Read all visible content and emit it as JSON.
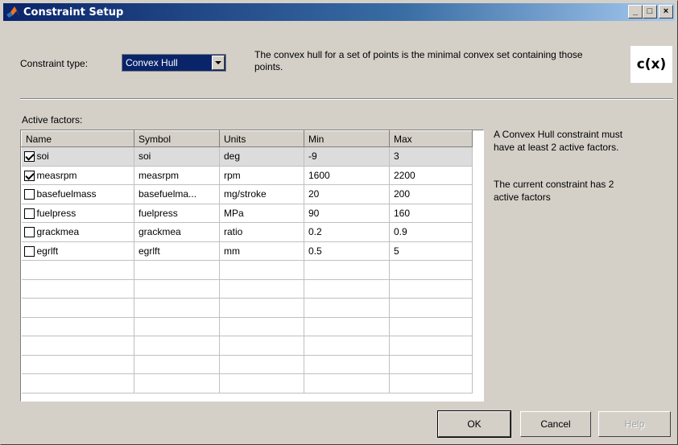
{
  "window": {
    "title": "Constraint Setup",
    "controls": {
      "minimize": "_",
      "maximize": "□",
      "close": "×"
    }
  },
  "constraint": {
    "type_label": "Constraint type:",
    "selected": "Convex Hull",
    "description": "The convex hull for a set of points is the minimal convex set containing those points.",
    "symbol": "c(x)"
  },
  "factors": {
    "label": "Active factors:",
    "columns": [
      "Name",
      "Symbol",
      "Units",
      "Min",
      "Max"
    ],
    "rows": [
      {
        "checked": true,
        "name": "soi",
        "symbol": "soi",
        "units": "deg",
        "min": "-9",
        "max": "3"
      },
      {
        "checked": true,
        "name": "measrpm",
        "symbol": "measrpm",
        "units": "rpm",
        "min": "1600",
        "max": "2200"
      },
      {
        "checked": false,
        "name": "basefuelmass",
        "symbol": "basefuelma...",
        "units": "mg/stroke",
        "min": "20",
        "max": "200"
      },
      {
        "checked": false,
        "name": "fuelpress",
        "symbol": "fuelpress",
        "units": "MPa",
        "min": "90",
        "max": "160"
      },
      {
        "checked": false,
        "name": "grackmea",
        "symbol": "grackmea",
        "units": "ratio",
        "min": "0.2",
        "max": "0.9"
      },
      {
        "checked": false,
        "name": "egrlft",
        "symbol": "egrlft",
        "units": "mm",
        "min": "0.5",
        "max": "5"
      }
    ]
  },
  "info": {
    "requirement_line1": "A Convex Hull constraint must",
    "requirement_line2": "have at least 2 active factors.",
    "status_line1": "The current constraint has 2",
    "status_line2": "active factors"
  },
  "buttons": {
    "ok": "OK",
    "cancel": "Cancel",
    "help": "Help"
  },
  "colors": {
    "title_start": "#0a246a",
    "title_end": "#a6caf0",
    "dialog_bg": "#d4d0c8",
    "selection": "#0a246a"
  }
}
